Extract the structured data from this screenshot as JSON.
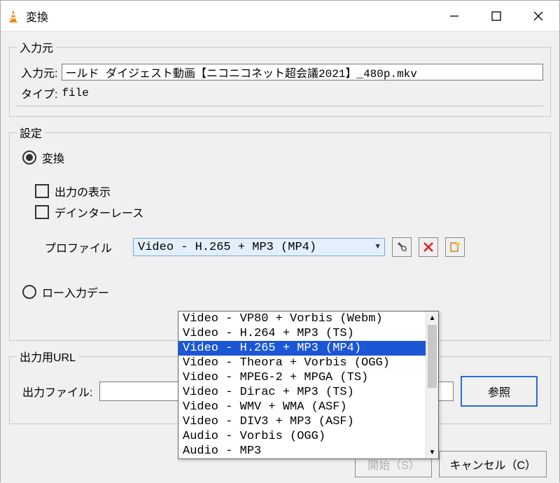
{
  "titlebar": {
    "title": "変換"
  },
  "source": {
    "legend": "入力元",
    "label": "入力元:",
    "value": "ールド ダイジェスト動画【ニコニコネット超会議2021】_480p.mkv",
    "type_label": "タイプ:",
    "type_value": "file"
  },
  "settings": {
    "legend": "設定",
    "radio_convert": "変換",
    "check_display": "出力の表示",
    "check_deint": "デインターレース",
    "profile_label": "プロファイル",
    "profile_selected": "Video - H.265 + MP3 (MP4)",
    "profile_options": [
      "Video - VP80 + Vorbis (Webm)",
      "Video - H.264 + MP3 (TS)",
      "Video - H.265 + MP3 (MP4)",
      "Video - Theora + Vorbis (OGG)",
      "Video - MPEG-2 + MPGA (TS)",
      "Video - Dirac + MP3 (TS)",
      "Video - WMV + WMA (ASF)",
      "Video - DIV3 + MP3 (ASF)",
      "Audio - Vorbis (OGG)",
      "Audio - MP3"
    ],
    "radio_raw": "ロー入力デー"
  },
  "output": {
    "legend": "出力用URL",
    "file_label": "出力ファイル:",
    "browse": "参照"
  },
  "buttons": {
    "start": "開始（S）",
    "cancel": "キャンセル（C）"
  }
}
